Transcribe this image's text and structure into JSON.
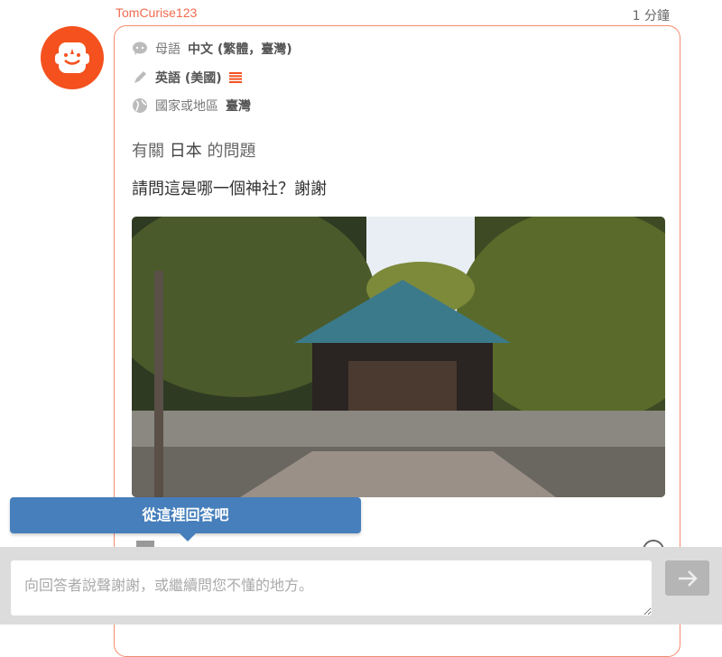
{
  "post": {
    "username": "TomCurise123",
    "time": "1 分鐘",
    "native_label": "母語",
    "native_value": "中文 (繁體，臺灣)",
    "learning_value": "英語 (美國)",
    "country_label": "國家或地區",
    "country_value": "臺灣",
    "about_prefix": "有關",
    "about_topic": "日本",
    "about_suffix": "的問題",
    "question": "請問這是哪一個神社？謝謝"
  },
  "tooltip": "從這裡回答吧",
  "reply": {
    "placeholder": "向回答者說聲謝謝，或繼續問您不懂的地方。"
  },
  "colors": {
    "accent": "#f26b4f",
    "tooltip": "#467fbb"
  }
}
